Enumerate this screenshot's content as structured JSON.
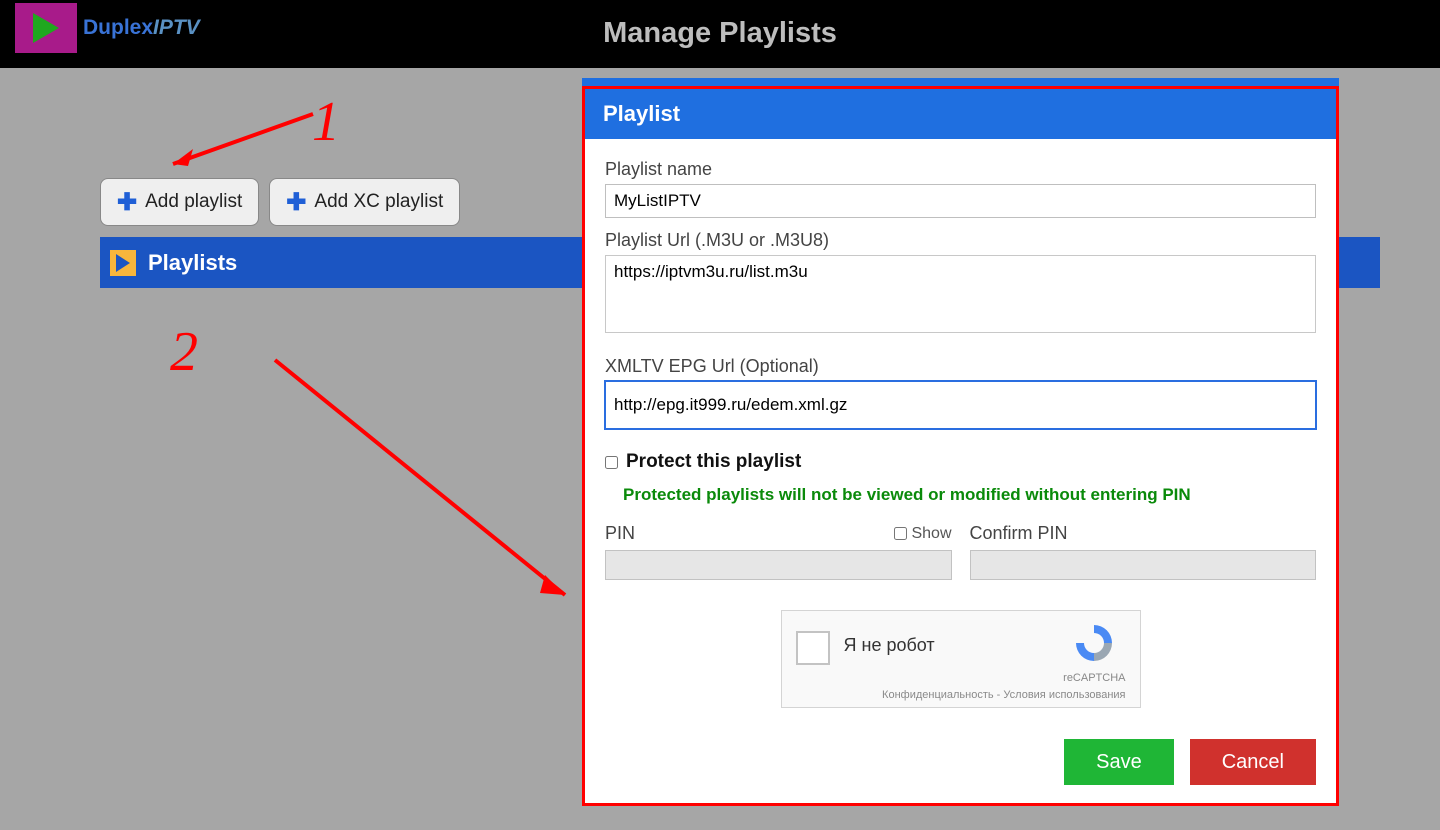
{
  "header": {
    "brand_part1": "Duplex",
    "brand_part2": "IPTV",
    "page_title": "Manage Playlists"
  },
  "toolbar": {
    "add_playlist": "Add playlist",
    "add_xc_playlist": "Add XC playlist"
  },
  "sidebar": {
    "playlists_label": "Playlists"
  },
  "annotations": {
    "one": "1",
    "two": "2"
  },
  "modal": {
    "title": "Playlist",
    "name_label": "Playlist name",
    "name_value": "MyListIPTV",
    "url_label": "Playlist Url (.M3U or .M3U8)",
    "url_value": "https://iptvm3u.ru/list.m3u",
    "epg_label": "XMLTV EPG Url (Optional)",
    "epg_value": "http://epg.it999.ru/edem.xml.gz",
    "protect_label": "Protect this playlist",
    "protect_hint": "Protected playlists will not be viewed or modified without entering PIN",
    "pin_label": "PIN",
    "show_label": "Show",
    "confirm_pin_label": "Confirm PIN",
    "save_label": "Save",
    "cancel_label": "Cancel"
  },
  "captcha": {
    "text": "Я не робот",
    "brand": "reCAPTCHA",
    "footer": "Конфиденциальность - Условия использования"
  }
}
